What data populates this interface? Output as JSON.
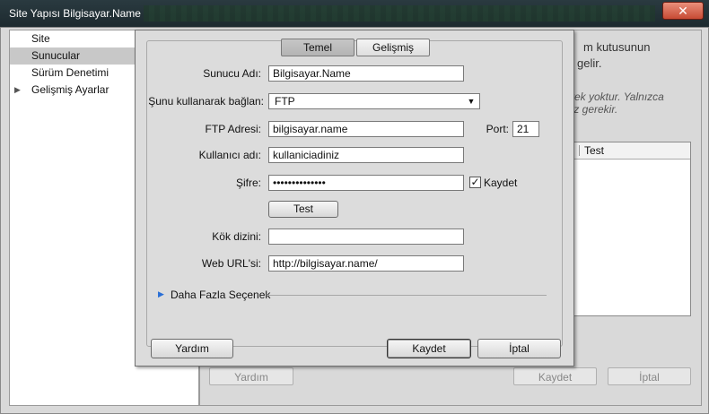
{
  "window": {
    "title": "Site Yapısı Bilgisayar.Name",
    "close_glyph": "✕"
  },
  "sidebar": {
    "items": [
      {
        "label": "Site",
        "selected": false,
        "expandable": false
      },
      {
        "label": "Sunucular",
        "selected": true,
        "expandable": false
      },
      {
        "label": "Sürüm Denetimi",
        "selected": false,
        "expandable": false
      },
      {
        "label": "Gelişmiş Ayarlar",
        "selected": false,
        "expandable": true
      }
    ]
  },
  "background": {
    "text1": "m kutusunun",
    "text2": "gelir.",
    "text3": "rek yoktur. Yalnızca",
    "text4": "ız gerekir.",
    "table_header": "Test",
    "help_button": "Yardım",
    "save_button": "Kaydet",
    "cancel_button": "İptal"
  },
  "dialog": {
    "tabs": [
      {
        "label": "Temel",
        "active": true
      },
      {
        "label": "Gelişmiş",
        "active": false
      }
    ],
    "fields": {
      "server_name_label": "Sunucu Adı:",
      "server_name_value": "Bilgisayar.Name",
      "connect_using_label": "Şunu kullanarak bağlan:",
      "connect_using_value": "FTP",
      "ftp_address_label": "FTP Adresi:",
      "ftp_address_value": "bilgisayar.name",
      "port_label": "Port:",
      "port_value": "21",
      "username_label": "Kullanıcı adı:",
      "username_value": "kullaniciadiniz",
      "password_label": "Şifre:",
      "password_value": "••••••••••••••",
      "save_password_label": "Kaydet",
      "save_password_checked": true,
      "test_button": "Test",
      "root_dir_label": "Kök dizini:",
      "root_dir_value": "",
      "web_url_label": "Web URL'si:",
      "web_url_value": "http://bilgisayar.name/"
    },
    "more_options_label": "Daha Fazla Seçenek",
    "buttons": {
      "help": "Yardım",
      "save": "Kaydet",
      "cancel": "İptal"
    }
  },
  "colors": {
    "accent": "#2a6fd6",
    "selection": "#c8c8c8",
    "titlebar": "#1d2a2f",
    "close": "#c74a34"
  },
  "icons": {
    "dropdown": "▼",
    "checkmark": "✓",
    "expand": "▶"
  }
}
